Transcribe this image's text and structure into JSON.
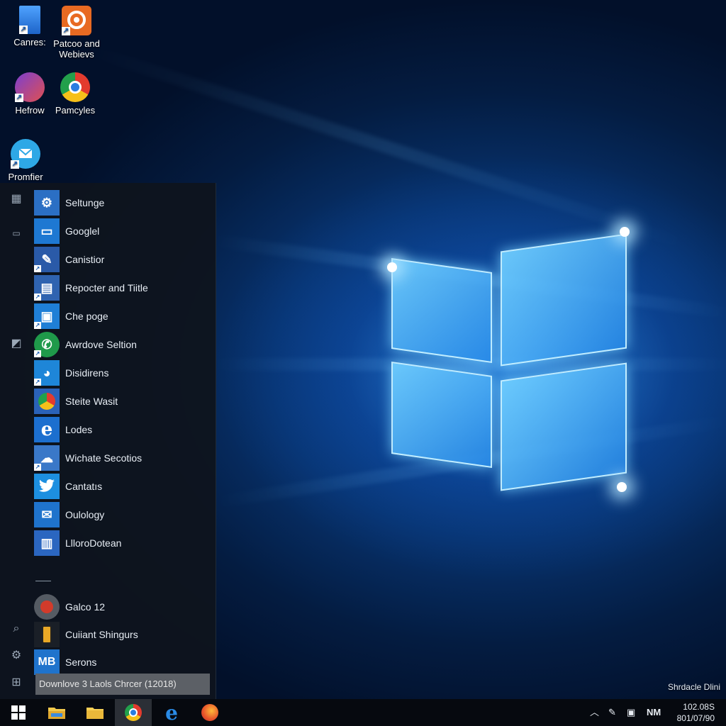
{
  "desktop": {
    "icons": [
      {
        "label": "Canres:",
        "icon": "folder-icon"
      },
      {
        "label": "Patcoo and Webievs",
        "icon": "media-app-icon"
      },
      {
        "label": "Hefrow",
        "icon": "app-icon"
      },
      {
        "label": "Pamcyles",
        "icon": "chrome-icon"
      },
      {
        "label": "Promfier",
        "icon": "mail-icon"
      }
    ],
    "corner_text": "Shrdacle Dlini"
  },
  "start_menu": {
    "apps": [
      {
        "label": "Seltunge",
        "icon": "settings-app-icon",
        "color": "#2b6fc4"
      },
      {
        "label": "Googlel",
        "icon": "window-app-icon",
        "color": "#1e78d2"
      },
      {
        "label": "Canistior",
        "icon": "tools-app-icon",
        "color": "#2a5aa8"
      },
      {
        "label": "Repocter and Tiitle",
        "icon": "report-app-icon",
        "color": "#2f63b0"
      },
      {
        "label": "Che poge",
        "icon": "store-app-icon",
        "color": "#1f7fd6"
      },
      {
        "label": "Awrdove Seltion",
        "icon": "phone-app-icon",
        "color": "#1f9a4a"
      },
      {
        "label": "Disidirens",
        "icon": "edge-app-icon",
        "color": "#1e86d8"
      },
      {
        "label": "Steite Wasit",
        "icon": "browser-app-icon",
        "color": "#2a62b8"
      },
      {
        "label": "Lodes",
        "icon": "internet-explorer-icon",
        "color": "#1c6fcf"
      },
      {
        "label": "Wichate Secotios",
        "icon": "cloud-app-icon",
        "color": "#3a78c8"
      },
      {
        "label": "Cantatıs",
        "icon": "twitter-icon",
        "color": "#1d8fe0"
      },
      {
        "label": "Oulology",
        "icon": "mail-app-icon",
        "color": "#1f73cc"
      },
      {
        "label": "LlloroDotean",
        "icon": "chart-app-icon",
        "color": "#2b66c0"
      }
    ],
    "extra_apps": [
      {
        "label": "Galco 12",
        "icon": "record-app-icon",
        "color": "#555b63"
      },
      {
        "label": "Cuiiant Shingurs",
        "icon": "phone-device-icon",
        "color": "#1a1f27"
      },
      {
        "label": "Serons",
        "icon": "mb-app-icon",
        "tile_text": "MB",
        "color": "#1f73cc"
      }
    ],
    "banner": "Downlove 3 Laols Chrcer (12018)"
  },
  "taskbar": {
    "apps": [
      {
        "icon": "file-explorer-icon"
      },
      {
        "icon": "folder-icon"
      },
      {
        "icon": "chrome-icon"
      },
      {
        "icon": "internet-explorer-icon"
      },
      {
        "icon": "firefox-icon"
      }
    ],
    "tray_text": "NM",
    "clock_time": "102.08S",
    "clock_date": "801/07/90"
  }
}
